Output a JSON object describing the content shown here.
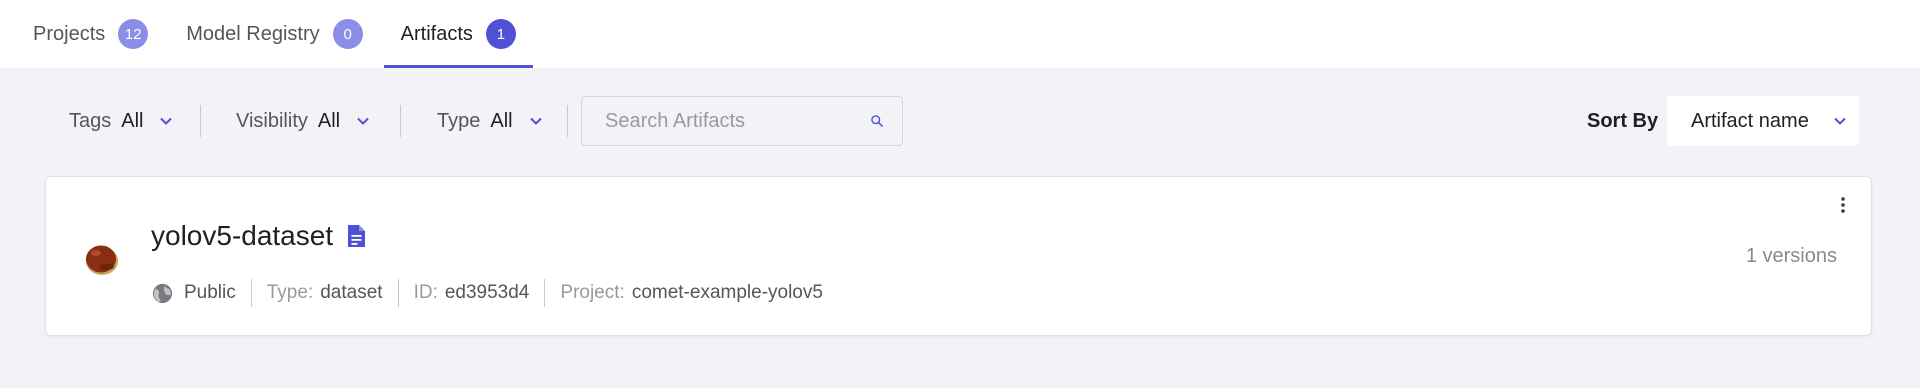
{
  "tabs": [
    {
      "label": "Projects",
      "count": "12"
    },
    {
      "label": "Model Registry",
      "count": "0"
    },
    {
      "label": "Artifacts",
      "count": "1"
    }
  ],
  "filters": {
    "tags": {
      "label": "Tags",
      "value": "All"
    },
    "visibility": {
      "label": "Visibility",
      "value": "All"
    },
    "type": {
      "label": "Type",
      "value": "All"
    }
  },
  "search": {
    "placeholder": "Search Artifacts",
    "value": ""
  },
  "sort": {
    "label": "Sort By",
    "value": "Artifact name"
  },
  "artifact": {
    "name": "yolov5-dataset",
    "visibility": "Public",
    "type_label": "Type:",
    "type_value": "dataset",
    "id_label": "ID:",
    "id_value": "ed3953d4",
    "project_label": "Project:",
    "project_value": "comet-example-yolov5",
    "versions": "1 versions"
  },
  "colors": {
    "accent": "#4f52d6",
    "badge_inactive": "#8a8ee8",
    "background": "#f3f2f6"
  },
  "icons": {
    "search": "search-icon",
    "chevron": "chevron-down-icon",
    "document": "document-icon",
    "globe": "globe-icon",
    "more": "more-vertical-icon",
    "avatar": "chestnut-avatar"
  }
}
